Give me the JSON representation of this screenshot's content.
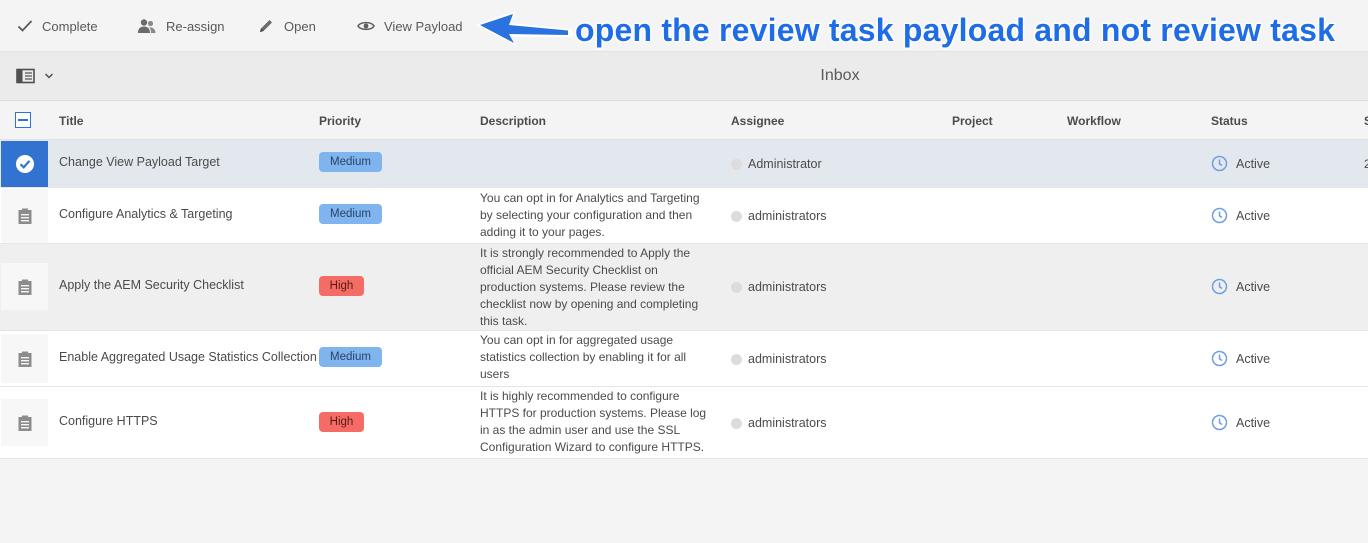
{
  "toolbar": {
    "complete_label": "Complete",
    "reassign_label": "Re-assign",
    "open_label": "Open",
    "view_payload_label": "View Payload"
  },
  "annotation": {
    "text": "open the review task payload and not review task",
    "color": "#1e6de6"
  },
  "header": {
    "title": "Inbox",
    "rail_icon": "sidebar-toggle-icon"
  },
  "columns": {
    "title": "Title",
    "priority": "Priority",
    "description": "Description",
    "assignee": "Assignee",
    "project": "Project",
    "workflow": "Workflow",
    "status": "Status",
    "start_partial": "S"
  },
  "rows": [
    {
      "title": "Change View Payload Target",
      "priority": "Medium",
      "description": "",
      "assignee": "Administrator",
      "status": "Active",
      "date_partial": "2"
    },
    {
      "title": "Configure Analytics & Targeting",
      "priority": "Medium",
      "description": "You can opt in for Analytics and Targeting by selecting your configuration and then adding it to your pages.",
      "assignee": "administrators",
      "status": "Active"
    },
    {
      "title": "Apply the AEM Security Checklist",
      "priority": "High",
      "description": "It is strongly recommended to Apply the official AEM Security Checklist on production systems. Please review the checklist now by opening and completing this task.",
      "assignee": "administrators",
      "status": "Active"
    },
    {
      "title": "Enable Aggregated Usage Statistics Collection",
      "priority": "Medium",
      "description": "You can opt in for aggregated usage statistics collection by enabling it for all users",
      "assignee": "administrators",
      "status": "Active"
    },
    {
      "title": "Configure HTTPS",
      "priority": "High",
      "description": "It is highly recommended to configure HTTPS for production systems. Please log in as the admin user and use the SSL Configuration Wizard to configure HTTPS.",
      "assignee": "administrators",
      "status": "Active"
    }
  ],
  "colors": {
    "medium_badge": "#7fb4ee",
    "high_badge": "#f46c65",
    "selection": "#3273d2",
    "status_icon": "#6e9fe0"
  }
}
